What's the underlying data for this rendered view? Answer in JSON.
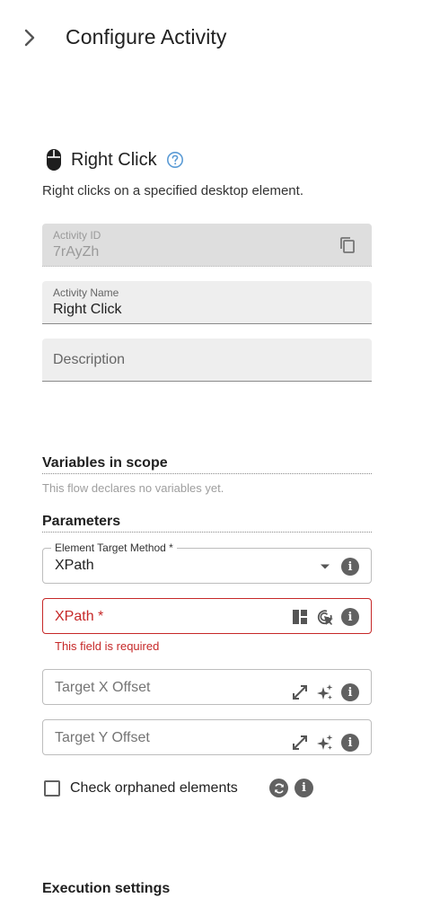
{
  "header": {
    "title": "Configure Activity"
  },
  "activity": {
    "name": "Right Click",
    "description": "Right clicks on a specified desktop element."
  },
  "fields": {
    "activity_id": {
      "label": "Activity ID",
      "value": "7rAyZh"
    },
    "activity_name": {
      "label": "Activity Name",
      "value": "Right Click"
    },
    "description": {
      "placeholder": "Description"
    }
  },
  "variables": {
    "title": "Variables in scope",
    "note": "This flow declares no variables yet."
  },
  "parameters": {
    "title": "Parameters",
    "target_method": {
      "label": "Element Target Method *",
      "value": "XPath"
    },
    "xpath": {
      "label": "XPath *",
      "error": "This field is required"
    },
    "target_x": {
      "placeholder": "Target X Offset"
    },
    "target_y": {
      "placeholder": "Target Y Offset"
    },
    "check_orphaned": {
      "label": "Check orphaned elements",
      "checked": false
    }
  },
  "execution": {
    "title": "Execution settings"
  },
  "colors": {
    "error": "#c62828",
    "help": "#5b9bd5",
    "icon": "#616161"
  }
}
